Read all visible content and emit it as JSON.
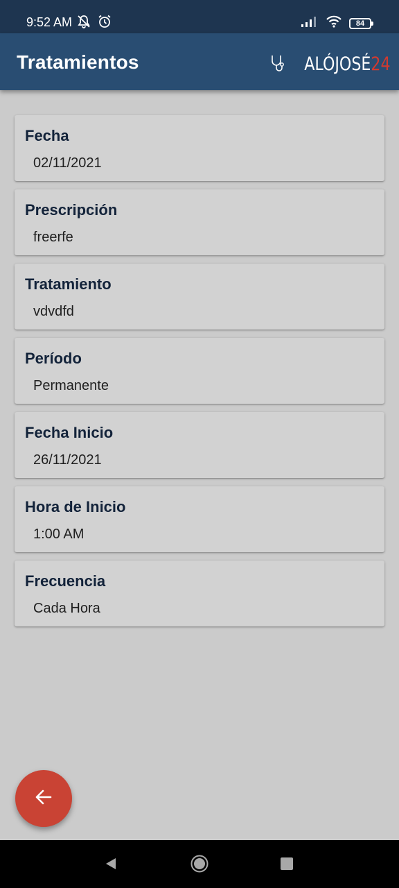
{
  "status_bar": {
    "time": "9:52 AM",
    "icons_left": [
      "bell-off-icon",
      "alarm-icon"
    ],
    "icons_right": [
      "signal-icon",
      "wifi-icon",
      "battery-icon"
    ],
    "battery_level": "84"
  },
  "app_bar": {
    "title": "Tratamientos",
    "logo": {
      "text": "ALÓJOSÉ",
      "number": "24",
      "icon": "stethoscope-icon"
    }
  },
  "cards": [
    {
      "label": "Fecha",
      "value": "02/11/2021"
    },
    {
      "label": "Prescripción",
      "value": "freerfe"
    },
    {
      "label": "Tratamiento",
      "value": "vdvdfd"
    },
    {
      "label": "Período",
      "value": "Permanente"
    },
    {
      "label": "Fecha Inicio",
      "value": "26/11/2021"
    },
    {
      "label": "Hora de Inicio",
      "value": "1:00 AM"
    },
    {
      "label": "Frecuencia",
      "value": "Cada Hora"
    }
  ],
  "fab": {
    "icon": "arrow-left-icon"
  },
  "nav_bar": {
    "buttons": [
      "nav-back-icon",
      "nav-home-icon",
      "nav-recents-icon"
    ]
  },
  "colors": {
    "status_bar_bg": "#1e3550",
    "app_bar_bg": "#294d72",
    "page_bg": "#cbcbcb",
    "card_bg": "#d2d2d2",
    "label_color": "#13233a",
    "fab_bg": "#c94334",
    "logo_accent": "#d13a2f"
  }
}
